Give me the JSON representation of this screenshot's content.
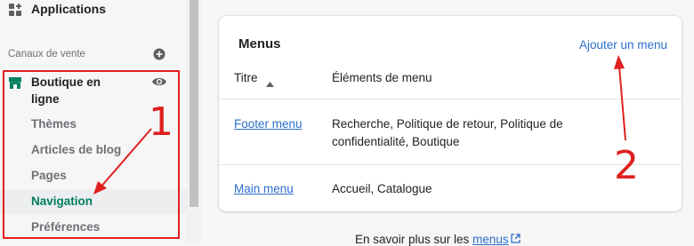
{
  "sidebar": {
    "apps_label": "Applications",
    "section_title": "Canaux de vente",
    "channel_label": "Boutique en ligne",
    "items": [
      {
        "label": "Thèmes"
      },
      {
        "label": "Articles de blog"
      },
      {
        "label": "Pages"
      },
      {
        "label": "Navigation",
        "active": true
      },
      {
        "label": "Préférences"
      }
    ]
  },
  "card": {
    "title": "Menus",
    "add_label": "Ajouter un menu",
    "columns": [
      "Titre",
      "Éléments de menu"
    ],
    "rows": [
      {
        "title": "Footer menu",
        "items": "Recherche, Politique de retour, Politique de confidentialité, Boutique"
      },
      {
        "title": "Main menu",
        "items": "Accueil, Catalogue"
      }
    ]
  },
  "footer": {
    "text": "En savoir plus sur les",
    "link": "menus"
  },
  "annotations": {
    "label_1": "1",
    "label_2": "2",
    "color": "#e02020"
  },
  "colors": {
    "accent_link": "#2c6ecb",
    "active_nav": "#007f5f",
    "store_icon": "#008060"
  }
}
